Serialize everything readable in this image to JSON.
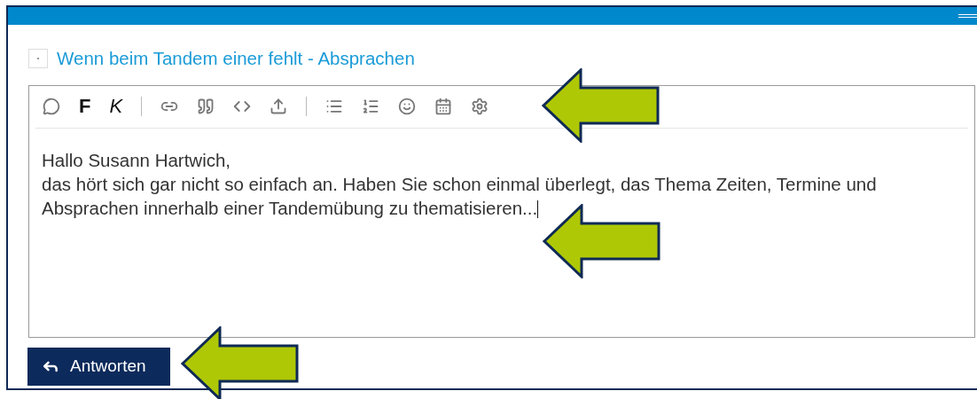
{
  "topic": {
    "title": "Wenn beim Tandem einer fehlt - Absprachen",
    "checked": false
  },
  "toolbar": [
    {
      "kind": "icon"
    },
    {
      "kind": "bold",
      "label": "F"
    },
    {
      "kind": "italic",
      "label": "K"
    },
    {
      "kind": "separator"
    },
    {
      "kind": "icon"
    },
    {
      "kind": "icon"
    },
    {
      "kind": "icon"
    },
    {
      "kind": "icon"
    },
    {
      "kind": "separator"
    },
    {
      "kind": "icon"
    },
    {
      "kind": "icon"
    },
    {
      "kind": "icon"
    },
    {
      "kind": "icon"
    },
    {
      "kind": "icon"
    }
  ],
  "editor": {
    "lines": [
      "Hallo Susann Hartwich,",
      "das hört sich gar nicht so einfach an. Haben Sie schon einmal überlegt, das Thema Zeiten, Termine und",
      "Absprachen innerhalb einer Tandemübung zu thematisieren..."
    ],
    "focused": true
  },
  "reply_button": {
    "label": "Antworten"
  }
}
